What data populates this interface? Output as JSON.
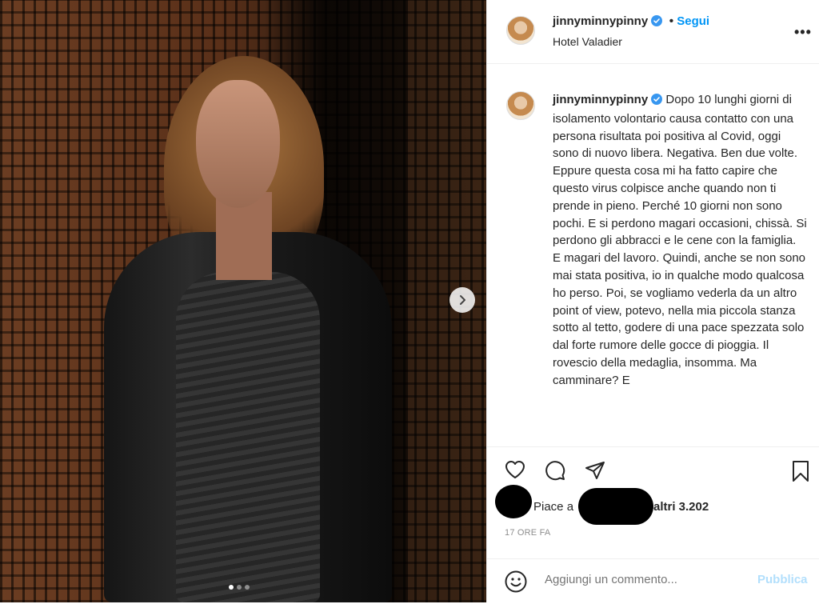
{
  "post": {
    "username": "jinnyminnypinny",
    "follow_label": "Segui",
    "separator": "•",
    "location": "Hotel Valadier",
    "more_label": "•••",
    "caption": "Dopo 10 lunghi giorni di isolamento volontario causa contatto con una persona risultata poi positiva al Covid, oggi sono di nuovo libera. Negativa. Ben due volte. Eppure questa cosa mi ha fatto capire che questo virus colpisce anche quando non ti prende in pieno. Perché 10 giorni non sono pochi. E si perdono magari occasioni, chissà. Si perdono gli abbracci e le cene con la famiglia. E magari del lavoro. Quindi, anche se non sono mai stata positiva, io in qualche modo qualcosa ho perso. Poi, se vogliamo vederla da un altro point of view, potevo, nella mia piccola stanza sotto al tetto, godere di una pace spezzata solo dal forte rumore delle gocce di pioggia. Il rovescio della medaglia, insomma. Ma camminare? E"
  },
  "carousel": {
    "total_slides": 3,
    "active_slide": 1
  },
  "likes": {
    "prefix": "Piace a",
    "suffix": "altri 3.202"
  },
  "timestamp": "17 ORE FA",
  "comment": {
    "placeholder": "Aggiungi un commento...",
    "publish_label": "Pubblica"
  },
  "colors": {
    "accent": "#0095f6",
    "verified": "#3897f0",
    "publish_disabled": "#b2dffc",
    "text": "#262626",
    "muted": "#8e8e8e"
  },
  "icons": [
    "verified-badge-icon",
    "more-options-icon",
    "next-arrow-icon",
    "heart-icon",
    "comment-icon",
    "share-icon",
    "bookmark-icon",
    "emoji-icon"
  ]
}
